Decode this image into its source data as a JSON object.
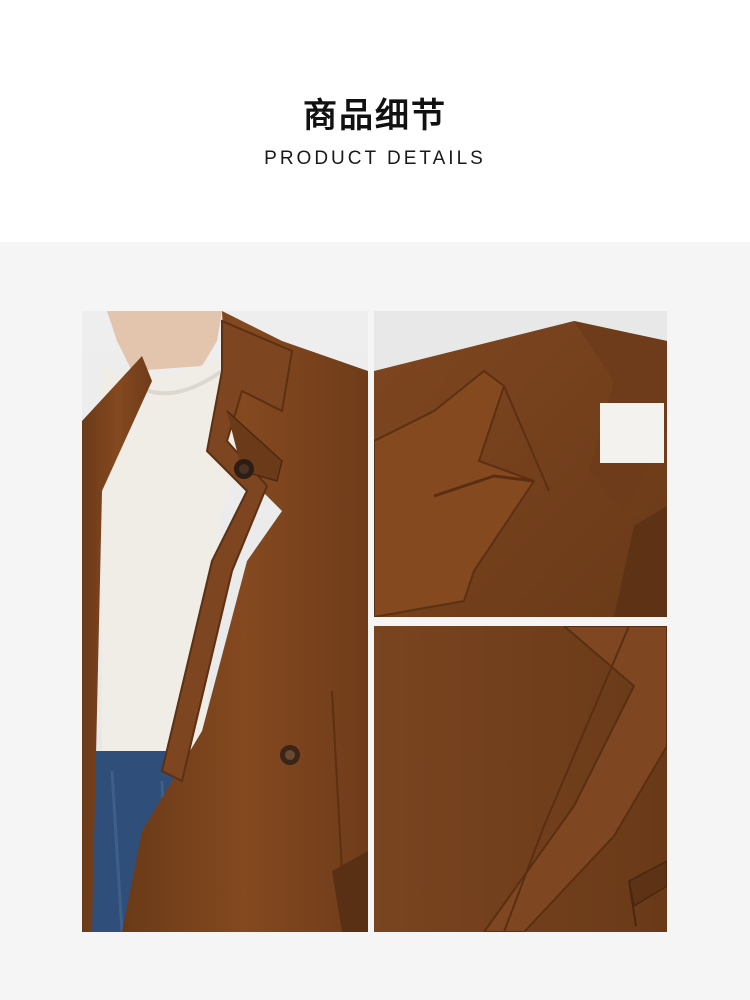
{
  "header": {
    "title_cn": "商品细节",
    "title_en": "PRODUCT DETAILS"
  },
  "gallery": {
    "photos": [
      {
        "subject": "model-wearing-brown-wool-coat"
      },
      {
        "subject": "coat-lapel-collar-closeup"
      },
      {
        "subject": "coat-pocket-fabric-closeup"
      }
    ]
  },
  "colors": {
    "coat_brown": "#7a4520",
    "background_gray": "#f5f5f5",
    "sweater_white": "#f0ede6",
    "denim_blue": "#2f4f7a"
  }
}
